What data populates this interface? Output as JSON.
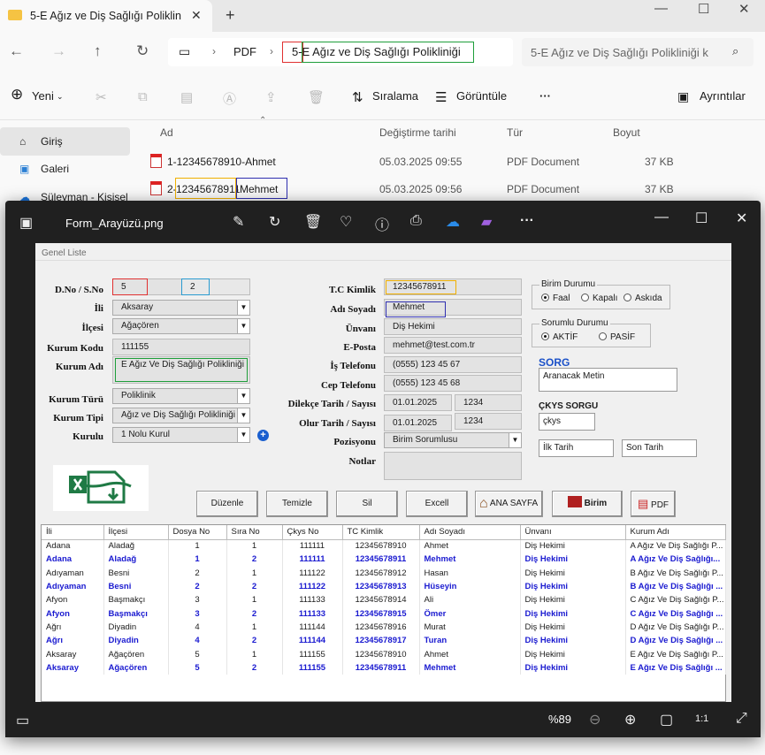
{
  "explorer": {
    "tab_title": "5-E Ağız ve Diş Sağlığı Poliklin",
    "breadcrumb": {
      "root": "PDF",
      "folder": "5-E Ağız ve Diş Sağlığı Polikliniği",
      "highlight_char": "5-"
    },
    "search_placeholder": "5-E Ağız ve Diş Sağlığı Polikliniği k",
    "toolbar": {
      "new": "Yeni",
      "sort": "Sıralama",
      "view": "Görüntüle",
      "details": "Ayrıntılar"
    },
    "nav": [
      {
        "label": "Giriş"
      },
      {
        "label": "Galeri"
      },
      {
        "label": "Süleyman - Kişisel"
      }
    ],
    "columns": {
      "name": "Ad",
      "modified": "Değiştirme tarihi",
      "type": "Tür",
      "size": "Boyut"
    },
    "files": [
      {
        "name": "1-12345678910-Ahmet",
        "modified": "05.03.2025 09:55",
        "type": "PDF Document",
        "size": "37 KB"
      },
      {
        "name_prefix": "2-",
        "name_tc": "12345678911",
        "name_dash": "-",
        "name_person": "Mehmet",
        "modified": "05.03.2025 09:56",
        "type": "PDF Document",
        "size": "37 KB"
      }
    ]
  },
  "viewer": {
    "title": "Form_Arayüzü.png",
    "zoom": "%89"
  },
  "form": {
    "header": "Genel Liste",
    "labels": {
      "dno": "D.No / S.No",
      "il": "İli",
      "ilce": "İlçesi",
      "kod": "Kurum Kodu",
      "ad": "Kurum Adı",
      "tur": "Kurum Türü",
      "tip": "Kurum Tipi",
      "kurulu": "Kurulu",
      "tc": "T.C Kimlik",
      "adsoyad": "Adı Soyadı",
      "unvan": "Ünvanı",
      "eposta": "E-Posta",
      "is": "İş Telefonu",
      "cep": "Cep Telefonu",
      "dilekce": "Dilekçe Tarih / Sayısı",
      "olur": "Olur Tarih / Sayısı",
      "pozisyon": "Pozisyonu",
      "notlar": "Notlar"
    },
    "values": {
      "dno": "5",
      "sno": "2",
      "il": "Aksaray",
      "ilce": "Ağaçören",
      "kod": "111155",
      "ad": "E Ağız Ve Diş Sağlığı Polikliniği",
      "tur": "Poliklinik",
      "tip": "Ağız ve Diş Sağlığı Polikliniği",
      "kurulu": "1 Nolu Kurul",
      "tc": "12345678911",
      "adsoyad": "Mehmet",
      "unvan": "Diş Hekimi",
      "eposta": "mehmet@test.com.tr",
      "is": "(0555) 123 45 67",
      "cep": "(0555) 123 45 68",
      "dilekce_tarih": "01.01.2025",
      "dilekce_sayi": "1234",
      "olur_tarih": "01.01.2025",
      "olur_sayi": "1234",
      "pozisyon": "Birim Sorumlusu"
    },
    "birim": {
      "title": "Birim Durumu",
      "opts": [
        "Faal",
        "Kapalı",
        "Askıda"
      ]
    },
    "sorumlu": {
      "title": "Sorumlu Durumu",
      "opts": [
        "AKTİF",
        "PASİF"
      ]
    },
    "sorg": {
      "title": "SORG",
      "placeholder": "Aranacak Metin"
    },
    "ckys": {
      "title": "ÇKYS SORGU",
      "value": "çkys",
      "ilk": "İlk Tarih",
      "son": "Son Tarih"
    },
    "buttons": [
      "Düzenle",
      "Temizle",
      "Sil",
      "Excell",
      "ANA SAYFA",
      "Birim",
      "PDF"
    ],
    "grid": {
      "headers": [
        "İli",
        "İlçesi",
        "Dosya No",
        "Sıra No",
        "Çkys No",
        "TC Kimlik",
        "Adı Soyadı",
        "Ünvanı",
        "Kurum Adı"
      ],
      "rows": [
        [
          "Adana",
          "Aladağ",
          "1",
          "1",
          "111111",
          "12345678910",
          "Ahmet",
          "Diş Hekimi",
          "A Ağız Ve Diş Sağlığı P..."
        ],
        [
          "Adana",
          "Aladağ",
          "1",
          "2",
          "111111",
          "12345678911",
          "Mehmet",
          "Diş Hekimi",
          "A Ağız Ve Diş Sağlığı..."
        ],
        [
          "Adıyaman",
          "Besni",
          "2",
          "1",
          "111122",
          "12345678912",
          "Hasan",
          "Diş Hekimi",
          "B Ağız Ve Diş Sağlığı P..."
        ],
        [
          "Adıyaman",
          "Besni",
          "2",
          "2",
          "111122",
          "12345678913",
          "Hüseyin",
          "Diş Hekimi",
          "B Ağız Ve Diş Sağlığı ..."
        ],
        [
          "Afyon",
          "Başmakçı",
          "3",
          "1",
          "111133",
          "12345678914",
          "Ali",
          "Diş Hekimi",
          "C Ağız Ve Diş Sağlığı P..."
        ],
        [
          "Afyon",
          "Başmakçı",
          "3",
          "2",
          "111133",
          "12345678915",
          "Ömer",
          "Diş Hekimi",
          "C Ağız Ve Diş Sağlığı ..."
        ],
        [
          "Ağrı",
          "Diyadin",
          "4",
          "1",
          "111144",
          "12345678916",
          "Murat",
          "Diş Hekimi",
          "D Ağız Ve Diş Sağlığı P..."
        ],
        [
          "Ağrı",
          "Diyadin",
          "4",
          "2",
          "111144",
          "12345678917",
          "Turan",
          "Diş Hekimi",
          "D Ağız Ve Diş Sağlığı ..."
        ],
        [
          "Aksaray",
          "Ağaçören",
          "5",
          "1",
          "111155",
          "12345678910",
          "Ahmet",
          "Diş Hekimi",
          "E Ağız Ve Diş Sağlığı P..."
        ],
        [
          "Aksaray",
          "Ağaçören",
          "5",
          "2",
          "111155",
          "12345678911",
          "Mehmet",
          "Diş Hekimi",
          "E Ağız Ve Diş Sağlığı ..."
        ]
      ]
    }
  }
}
